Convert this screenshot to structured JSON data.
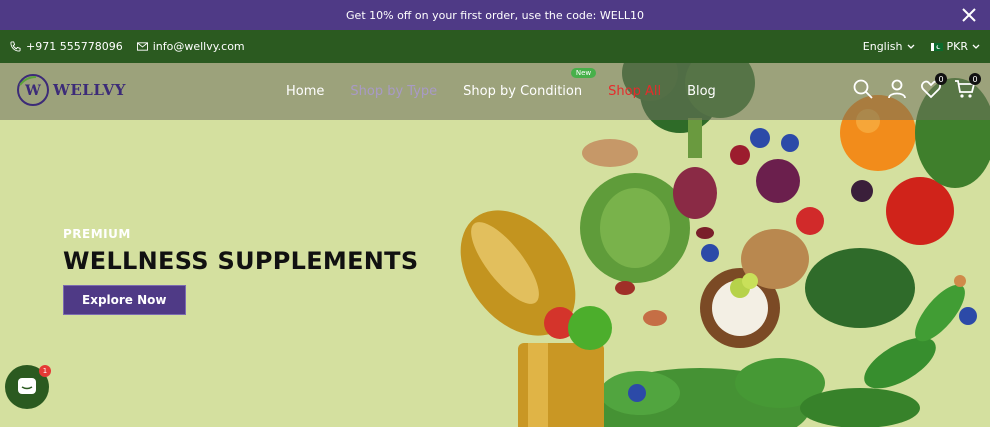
{
  "announcement": {
    "text": "Get 10% off on your first order, use the code: WELL10",
    "close_icon": "close-icon"
  },
  "contact": {
    "phone": "+971 555778096",
    "email": "info@wellvy.com"
  },
  "selectors": {
    "language": "English",
    "currency": "PKR"
  },
  "brand": {
    "name": "WELLVY",
    "mark": "W"
  },
  "nav": {
    "home": "Home",
    "shop_by_type": "Shop by Type",
    "shop_by_condition": "Shop by Condition",
    "new_badge": "New",
    "shop_all": "Shop All",
    "blog": "Blog"
  },
  "header_icons": {
    "wishlist_count": "0",
    "cart_count": "0"
  },
  "hero": {
    "eyebrow": "PREMIUM",
    "headline": "WELLNESS SUPPLEMENTS",
    "cta": "Explore Now"
  },
  "chat": {
    "unread": "1"
  },
  "colors": {
    "purple": "#4f3a86",
    "green": "#2b5a20",
    "hero_bg": "#d4e09f",
    "accent_red": "#e62b2b",
    "new_badge": "#47b04a"
  }
}
